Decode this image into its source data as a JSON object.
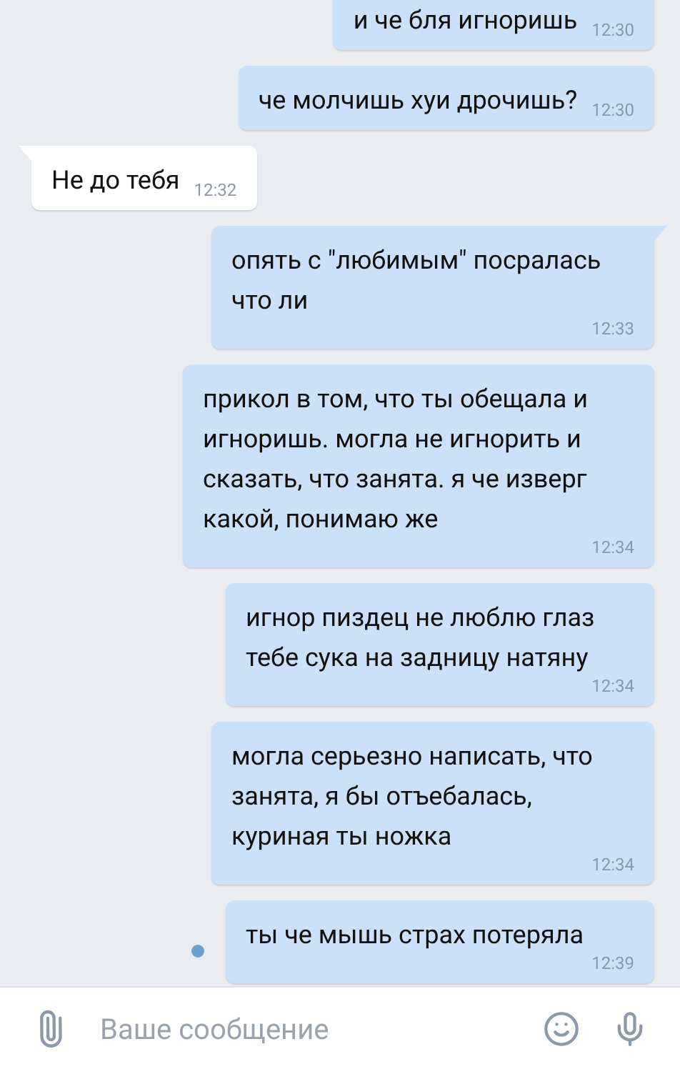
{
  "messages": [
    {
      "kind": "outgoing",
      "text": "и че бля игноришь",
      "time": "12:30"
    },
    {
      "kind": "outgoing",
      "text": "че молчишь хуи дрочишь?",
      "time": "12:30",
      "tail": false
    },
    {
      "kind": "incoming",
      "text": "Не до тебя",
      "time": "12:32",
      "tail": true
    },
    {
      "kind": "outgoing",
      "text": "опять с \"любимым\" посралась что ли",
      "time": "12:33",
      "tail": true
    },
    {
      "kind": "outgoing",
      "text": "прикол в том, что ты обещала и игноришь. могла не игнорить и сказать, что занята. я че изверг какой, понимаю же",
      "time": "12:34",
      "tail": false
    },
    {
      "kind": "outgoing",
      "text": "игнор пиздец не люблю глаз тебе сука на задницу натяну",
      "time": "12:34",
      "tail": false
    },
    {
      "kind": "outgoing",
      "text": "могла серьезно написать, что занята, я бы отъебалась, куриная ты ножка",
      "time": "12:34",
      "tail": false
    },
    {
      "kind": "outgoing",
      "text": "ты че мышь страх потеряла",
      "time": "12:39",
      "tail": false,
      "unread": true
    }
  ],
  "composer": {
    "placeholder": "Ваше сообщение"
  }
}
